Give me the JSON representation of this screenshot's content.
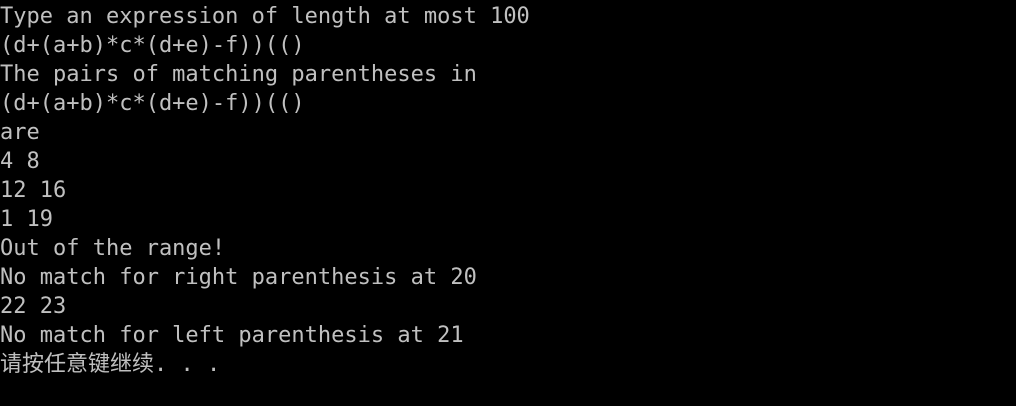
{
  "console": {
    "background": "#000000",
    "text_color": "#c0c0c0",
    "lines": [
      "Type an expression of length at most 100",
      "(d+(a+b)*c*(d+e)-f))(()",
      "The pairs of matching parentheses in",
      "(d+(a+b)*c*(d+e)-f))(()",
      "are",
      "4 8",
      "12 16",
      "1 19",
      "Out of the range!",
      "No match for right parenthesis at 20",
      "22 23",
      "No match for left parenthesis at 21",
      "请按任意键继续. . ."
    ]
  }
}
